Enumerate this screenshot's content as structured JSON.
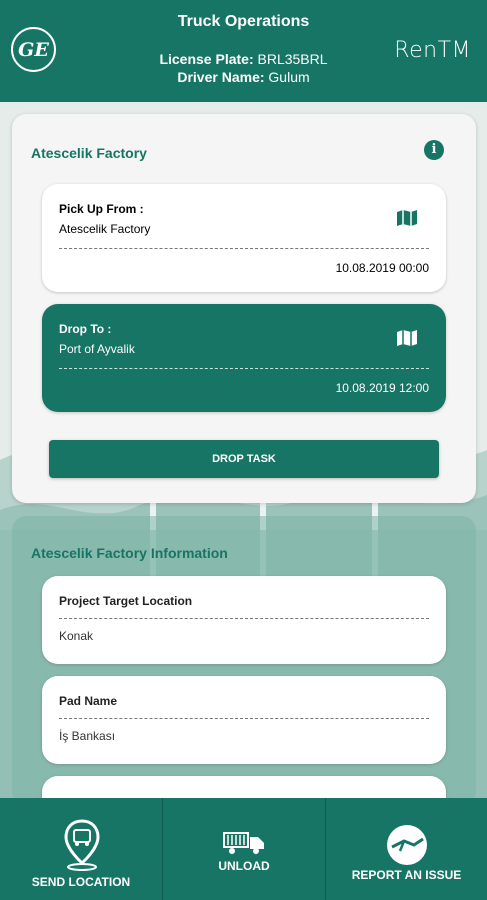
{
  "header": {
    "title": "Truck Operations",
    "license_label": "License Plate:",
    "license_value": "BRL35BRL",
    "driver_label": "Driver Name:",
    "driver_value": "Gulum",
    "logo_left": "GE",
    "logo_right": "RenTM"
  },
  "task": {
    "title": "Atescelik Factory",
    "pickup": {
      "label": "Pick Up From :",
      "value": "Atescelik Factory",
      "datetime": "10.08.2019 00:00"
    },
    "dropoff": {
      "label": "Drop To :",
      "value": "Port of Ayvalik",
      "datetime": "10.08.2019 12:00"
    },
    "drop_button": "DROP TASK"
  },
  "info": {
    "title": "Atescelik Factory Information",
    "items": [
      {
        "label": "Project Target Location",
        "value": "Konak"
      },
      {
        "label": "Pad Name",
        "value": "İş Bankası"
      }
    ]
  },
  "bottom_nav": {
    "send_location": "SEND LOCATION",
    "unload": "UNLOAD",
    "report": "REPORT AN ISSUE"
  },
  "colors": {
    "primary": "#177565",
    "background": "#e6ece9"
  },
  "icons": [
    "ge-logo",
    "info-icon",
    "map-icon",
    "location-pin-icon",
    "truck-icon",
    "issue-icon"
  ]
}
